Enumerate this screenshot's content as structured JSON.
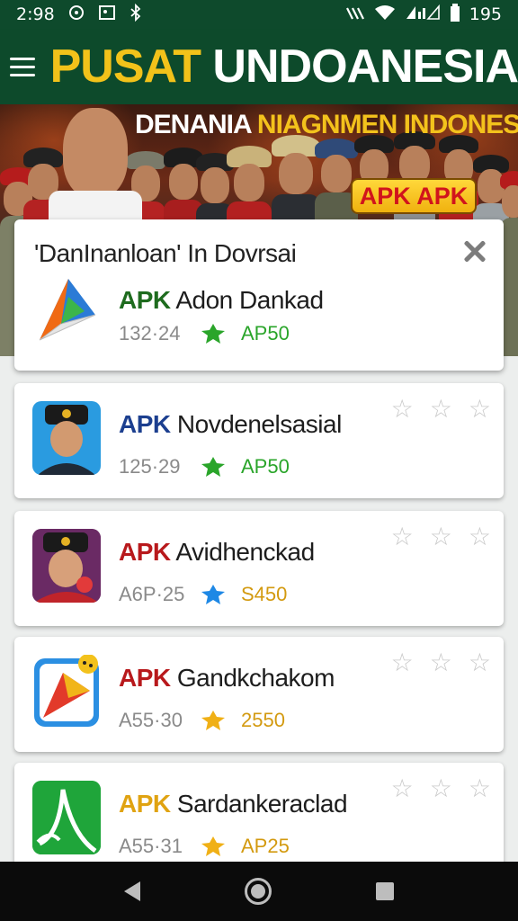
{
  "status_bar": {
    "time": "2:98",
    "battery": "195"
  },
  "app_bar": {
    "title_part1": "PUSAT",
    "title_part2": "UNDOANESIA"
  },
  "banner": {
    "headline_white": "DENANIA",
    "headline_yellow": "NIAGNMEN INDONESIA",
    "badge": "APK APK"
  },
  "dialog": {
    "title": "'DanInanloan' In Dovrsai",
    "item": {
      "apk": "APK",
      "apk_color": "#1e6b1e",
      "name": "Adon Dankad",
      "version": "132·24",
      "size": "AP50",
      "size_color": "#2aa52a",
      "badge_color": "#2aa52a",
      "icon": "play-triangle-icon"
    }
  },
  "items": [
    {
      "apk": "APK",
      "apk_color": "#1c3f8f",
      "name": "Novdenelsasial",
      "version": "125·29",
      "size": "AP50",
      "size_color": "#2aa52a",
      "badge_color": "#2aa52a",
      "icon": "police-officer-icon",
      "stars": [
        "☆",
        "☆",
        "☆"
      ]
    },
    {
      "apk": "APK",
      "apk_color": "#b8191c",
      "name": "Avidhenckad",
      "version": "A6P·25",
      "size": "S450",
      "size_color": "#d39a10",
      "badge_color": "#1e88e5",
      "icon": "officer-portrait-icon",
      "stars": [
        "☆",
        "☆",
        "☆"
      ]
    },
    {
      "apk": "APK",
      "apk_color": "#b8191c",
      "name": "Gandkchakom",
      "version": "A55·30",
      "size": "2550",
      "size_color": "#d39a10",
      "badge_color": "#f0b016",
      "icon": "arrow-logo-icon",
      "stars": [
        "☆",
        "☆",
        "☆"
      ]
    },
    {
      "apk": "APK",
      "apk_color": "#e0a312",
      "name": "Sardankeraclad",
      "version": "A55·31",
      "size": "AP25",
      "size_color": "#d39a10",
      "badge_color": "#f0b016",
      "icon": "green-signature-icon",
      "stars": [
        "☆",
        "☆",
        "☆"
      ]
    }
  ]
}
